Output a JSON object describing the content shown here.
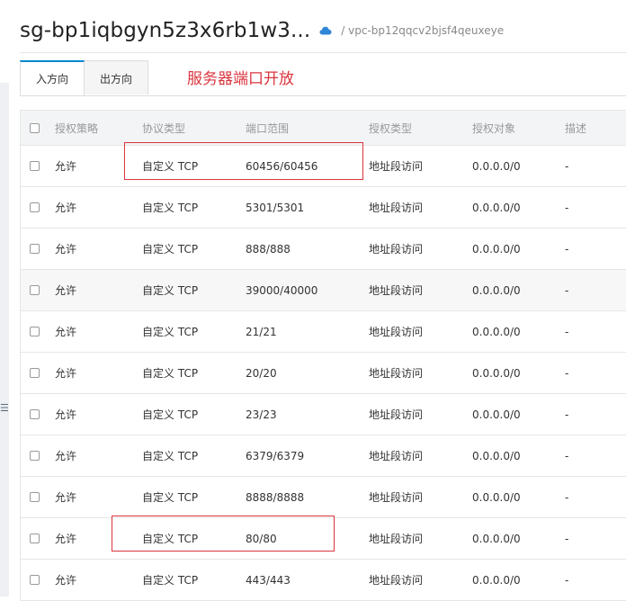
{
  "header": {
    "title": "sg-bp1iqbgyn5z3x6rb1w3...",
    "vpc": "/ vpc-bp12qqcv2bjsf4qeuxeye"
  },
  "tabs": [
    {
      "label": "入方向",
      "active": true
    },
    {
      "label": "出方向",
      "active": false
    }
  ],
  "annotation": "服务器端口开放",
  "table": {
    "columns": [
      "授权策略",
      "协议类型",
      "端口范围",
      "授权类型",
      "授权对象",
      "描述"
    ],
    "rows": [
      {
        "policy": "允许",
        "protocol": "自定义 TCP",
        "port": "60456/60456",
        "auth_type": "地址段访问",
        "target": "0.0.0.0/0",
        "desc": "-"
      },
      {
        "policy": "允许",
        "protocol": "自定义 TCP",
        "port": "5301/5301",
        "auth_type": "地址段访问",
        "target": "0.0.0.0/0",
        "desc": "-"
      },
      {
        "policy": "允许",
        "protocol": "自定义 TCP",
        "port": "888/888",
        "auth_type": "地址段访问",
        "target": "0.0.0.0/0",
        "desc": "-"
      },
      {
        "policy": "允许",
        "protocol": "自定义 TCP",
        "port": "39000/40000",
        "auth_type": "地址段访问",
        "target": "0.0.0.0/0",
        "desc": "-"
      },
      {
        "policy": "允许",
        "protocol": "自定义 TCP",
        "port": "21/21",
        "auth_type": "地址段访问",
        "target": "0.0.0.0/0",
        "desc": "-"
      },
      {
        "policy": "允许",
        "protocol": "自定义 TCP",
        "port": "20/20",
        "auth_type": "地址段访问",
        "target": "0.0.0.0/0",
        "desc": "-"
      },
      {
        "policy": "允许",
        "protocol": "自定义 TCP",
        "port": "23/23",
        "auth_type": "地址段访问",
        "target": "0.0.0.0/0",
        "desc": "-"
      },
      {
        "policy": "允许",
        "protocol": "自定义 TCP",
        "port": "6379/6379",
        "auth_type": "地址段访问",
        "target": "0.0.0.0/0",
        "desc": "-"
      },
      {
        "policy": "允许",
        "protocol": "自定义 TCP",
        "port": "8888/8888",
        "auth_type": "地址段访问",
        "target": "0.0.0.0/0",
        "desc": "-"
      },
      {
        "policy": "允许",
        "protocol": "自定义 TCP",
        "port": "80/80",
        "auth_type": "地址段访问",
        "target": "0.0.0.0/0",
        "desc": "-"
      },
      {
        "policy": "允许",
        "protocol": "自定义 TCP",
        "port": "443/443",
        "auth_type": "地址段访问",
        "target": "0.0.0.0/0",
        "desc": "-"
      }
    ]
  },
  "colors": {
    "annotation": "#d9363e",
    "tab_accent": "#0088cc",
    "cloud_icon": "#2f86d6"
  },
  "icons": {
    "vpc": "cloud-icon"
  }
}
